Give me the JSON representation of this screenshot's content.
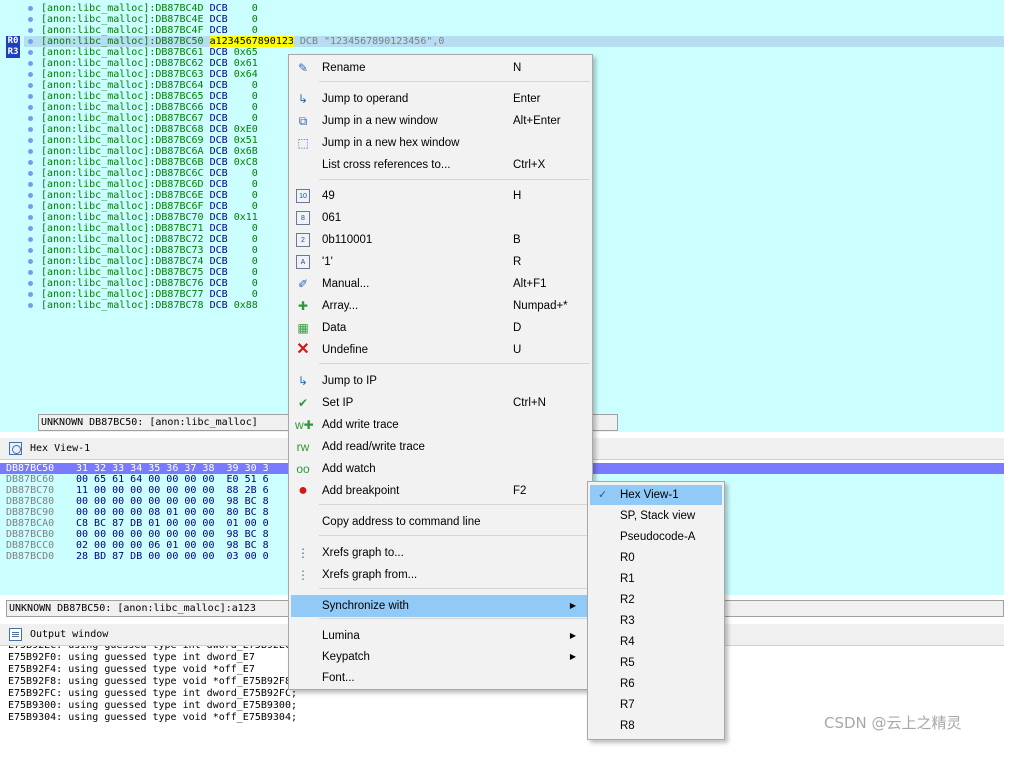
{
  "disasm": {
    "registers": [
      "R0",
      "R3"
    ],
    "lines": [
      {
        "addr": "[anon:libc_malloc]:DB87BC4D",
        "mn": "DCB",
        "val": "   0"
      },
      {
        "addr": "[anon:libc_malloc]:DB87BC4E",
        "mn": "DCB",
        "val": "   0"
      },
      {
        "addr": "[anon:libc_malloc]:DB87BC4F",
        "mn": "DCB",
        "val": "   0"
      },
      {
        "addr": "[anon:libc_malloc]:DB87BC50",
        "label": "a1234567890123",
        "rest": " DCB \"1234567890123456\",0"
      },
      {
        "addr": "[anon:libc_malloc]:DB87BC61",
        "mn": "DCB",
        "val": "0x65"
      },
      {
        "addr": "[anon:libc_malloc]:DB87BC62",
        "mn": "DCB",
        "val": "0x61"
      },
      {
        "addr": "[anon:libc_malloc]:DB87BC63",
        "mn": "DCB",
        "val": "0x64"
      },
      {
        "addr": "[anon:libc_malloc]:DB87BC64",
        "mn": "DCB",
        "val": "   0"
      },
      {
        "addr": "[anon:libc_malloc]:DB87BC65",
        "mn": "DCB",
        "val": "   0"
      },
      {
        "addr": "[anon:libc_malloc]:DB87BC66",
        "mn": "DCB",
        "val": "   0"
      },
      {
        "addr": "[anon:libc_malloc]:DB87BC67",
        "mn": "DCB",
        "val": "   0"
      },
      {
        "addr": "[anon:libc_malloc]:DB87BC68",
        "mn": "DCB",
        "val": "0xE0"
      },
      {
        "addr": "[anon:libc_malloc]:DB87BC69",
        "mn": "DCB",
        "val": "0x51"
      },
      {
        "addr": "[anon:libc_malloc]:DB87BC6A",
        "mn": "DCB",
        "val": "0x6B"
      },
      {
        "addr": "[anon:libc_malloc]:DB87BC6B",
        "mn": "DCB",
        "val": "0xC8"
      },
      {
        "addr": "[anon:libc_malloc]:DB87BC6C",
        "mn": "DCB",
        "val": "   0"
      },
      {
        "addr": "[anon:libc_malloc]:DB87BC6D",
        "mn": "DCB",
        "val": "   0"
      },
      {
        "addr": "[anon:libc_malloc]:DB87BC6E",
        "mn": "DCB",
        "val": "   0"
      },
      {
        "addr": "[anon:libc_malloc]:DB87BC6F",
        "mn": "DCB",
        "val": "   0"
      },
      {
        "addr": "[anon:libc_malloc]:DB87BC70",
        "mn": "DCB",
        "val": "0x11"
      },
      {
        "addr": "[anon:libc_malloc]:DB87BC71",
        "mn": "DCB",
        "val": "   0"
      },
      {
        "addr": "[anon:libc_malloc]:DB87BC72",
        "mn": "DCB",
        "val": "   0"
      },
      {
        "addr": "[anon:libc_malloc]:DB87BC73",
        "mn": "DCB",
        "val": "   0"
      },
      {
        "addr": "[anon:libc_malloc]:DB87BC74",
        "mn": "DCB",
        "val": "   0"
      },
      {
        "addr": "[anon:libc_malloc]:DB87BC75",
        "mn": "DCB",
        "val": "   0"
      },
      {
        "addr": "[anon:libc_malloc]:DB87BC76",
        "mn": "DCB",
        "val": "   0"
      },
      {
        "addr": "[anon:libc_malloc]:DB87BC77",
        "mn": "DCB",
        "val": "   0"
      },
      {
        "addr": "[anon:libc_malloc]:DB87BC78",
        "mn": "DCB",
        "val": "0x88"
      }
    ],
    "status": "UNKNOWN DB87BC50: [anon:libc_malloc]"
  },
  "hex_view": {
    "title": "Hex View-1",
    "rows": [
      {
        "addr": "DB87BC50",
        "bytes": "31 32 33 34 35 36 37 38  39 30 3"
      },
      {
        "addr": "DB87BC60",
        "bytes": "00 65 61 64 00 00 00 00  E0 51 6"
      },
      {
        "addr": "DB87BC70",
        "bytes": "11 00 00 00 00 00 00 00  88 2B 6"
      },
      {
        "addr": "DB87BC80",
        "bytes": "00 00 00 00 00 00 00 00  98 BC 8"
      },
      {
        "addr": "DB87BC90",
        "bytes": "00 00 00 00 08 01 00 00  80 BC 8"
      },
      {
        "addr": "DB87BCA0",
        "bytes": "C8 BC 87 DB 01 00 00 00  01 00 0"
      },
      {
        "addr": "DB87BCB0",
        "bytes": "00 00 00 00 00 00 00 00  98 BC 8"
      },
      {
        "addr": "DB87BCC0",
        "bytes": "02 00 00 00 06 01 00 00  98 BC 8"
      },
      {
        "addr": "DB87BCD0",
        "bytes": "28 BD 87 DB 00 00 00 00  03 00 0"
      }
    ],
    "status": "UNKNOWN DB87BC50: [anon:libc_malloc]:a123"
  },
  "output": {
    "title": "Output window",
    "lines": [
      "E75B92EC: using guessed type int dword_E75B92EC;",
      "E75B92F0: using guessed type int dword_E7",
      "E75B92F4: using guessed type void *off_E7",
      "E75B92F8: using guessed type void *off_E75B92F8;",
      "E75B92FC: using guessed type int dword_E75B92FC;",
      "E75B9300: using guessed type int dword_E75B9300;",
      "E75B9304: using guessed type void *off_E75B9304;"
    ]
  },
  "context_menu": {
    "items": [
      {
        "label": "Rename",
        "shortcut": "N",
        "icon": "rename-icon",
        "glyph": "✎"
      },
      {
        "label": "Jump to operand",
        "shortcut": "Enter",
        "icon": "jump-operand-icon",
        "glyph": "↳"
      },
      {
        "label": "Jump in a new window",
        "shortcut": "Alt+Enter",
        "icon": "jump-new-window-icon",
        "glyph": "⧉"
      },
      {
        "label": "Jump in a new hex window",
        "shortcut": "",
        "icon": "jump-hex-window-icon",
        "glyph": "⬚"
      },
      {
        "label": "List cross references to...",
        "shortcut": "Ctrl+X",
        "icon": "",
        "glyph": ""
      },
      {
        "label": "49",
        "shortcut": "H",
        "icon": "decimal-icon",
        "glyph": "10"
      },
      {
        "label": "061",
        "shortcut": "",
        "icon": "octal-icon",
        "glyph": "8"
      },
      {
        "label": "0b110001",
        "shortcut": "B",
        "icon": "binary-icon",
        "glyph": "2"
      },
      {
        "label": "'1'",
        "shortcut": "R",
        "icon": "char-icon",
        "glyph": "A"
      },
      {
        "label": "Manual...",
        "shortcut": "Alt+F1",
        "icon": "manual-icon",
        "glyph": "✐"
      },
      {
        "label": "Array...",
        "shortcut": "Numpad+*",
        "icon": "array-icon",
        "glyph": "✚"
      },
      {
        "label": "Data",
        "shortcut": "D",
        "icon": "data-icon",
        "glyph": "▦"
      },
      {
        "label": "Undefine",
        "shortcut": "U",
        "icon": "undefine-icon",
        "glyph": "✕"
      },
      {
        "label": "Jump to IP",
        "shortcut": "",
        "icon": "jump-ip-icon",
        "glyph": "↳"
      },
      {
        "label": "Set IP",
        "shortcut": "Ctrl+N",
        "icon": "set-ip-icon",
        "glyph": "✔"
      },
      {
        "label": "Add write trace",
        "shortcut": "",
        "icon": "write-trace-icon",
        "glyph": "w✚"
      },
      {
        "label": "Add read/write trace",
        "shortcut": "",
        "icon": "rw-trace-icon",
        "glyph": "rw"
      },
      {
        "label": "Add watch",
        "shortcut": "",
        "icon": "watch-icon",
        "glyph": "oo"
      },
      {
        "label": "Add breakpoint",
        "shortcut": "F2",
        "icon": "breakpoint-icon",
        "glyph": "●"
      },
      {
        "label": "Copy address to command line",
        "shortcut": "",
        "icon": "",
        "glyph": ""
      },
      {
        "label": "Xrefs graph to...",
        "shortcut": "",
        "icon": "xrefs-to-icon",
        "glyph": "⋮"
      },
      {
        "label": "Xrefs graph from...",
        "shortcut": "",
        "icon": "xrefs-from-icon",
        "glyph": "⋮"
      },
      {
        "label": "Synchronize with",
        "shortcut": "",
        "icon": "",
        "glyph": "",
        "submenu": true
      },
      {
        "label": "Lumina",
        "shortcut": "",
        "icon": "",
        "glyph": "",
        "submenu": true
      },
      {
        "label": "Keypatch",
        "shortcut": "",
        "icon": "",
        "glyph": "",
        "submenu": true
      },
      {
        "label": "Font...",
        "shortcut": "",
        "icon": "",
        "glyph": ""
      }
    ]
  },
  "sync_submenu": {
    "items": [
      {
        "label": "Hex View-1",
        "checked": true
      },
      {
        "label": "SP, Stack view",
        "checked": false
      },
      {
        "label": "Pseudocode-A",
        "checked": false
      },
      {
        "label": "R0",
        "checked": false
      },
      {
        "label": "R1",
        "checked": false
      },
      {
        "label": "R2",
        "checked": false
      },
      {
        "label": "R3",
        "checked": false
      },
      {
        "label": "R4",
        "checked": false
      },
      {
        "label": "R5",
        "checked": false
      },
      {
        "label": "R6",
        "checked": false
      },
      {
        "label": "R7",
        "checked": false
      },
      {
        "label": "R8",
        "checked": false
      }
    ]
  },
  "watermark": "CSDN @云上之精灵"
}
